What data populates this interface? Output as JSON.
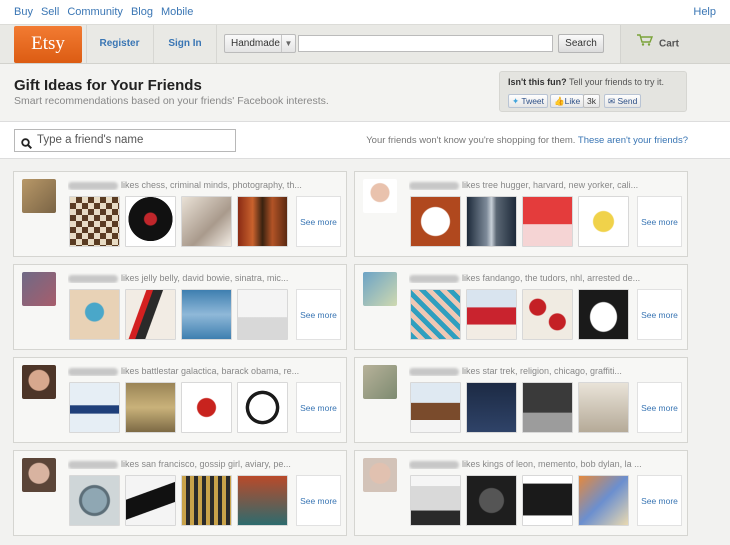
{
  "topnav": {
    "items": [
      "Buy",
      "Sell",
      "Community",
      "Blog",
      "Mobile"
    ],
    "help": "Help"
  },
  "header": {
    "logo": "Etsy",
    "register": "Register",
    "signin": "Sign In",
    "category": "Handmade",
    "search_value": "",
    "search_button": "Search",
    "cart": "Cart"
  },
  "hero": {
    "title": "Gift Ideas for Your Friends",
    "subtitle": "Smart recommendations based on your friends' Facebook interests.",
    "share_question": "Isn't this fun?",
    "share_prompt": "Tell your friends to try it.",
    "tweet": "Tweet",
    "like": "Like",
    "like_count": "3k",
    "send": "Send"
  },
  "finder": {
    "placeholder": "Type a friend's name",
    "note": "Your friends won't know you're shopping for them.",
    "note_link": "These aren't your friends?"
  },
  "accent": "#3a76b4",
  "brand": "#f1641e",
  "cards": [
    {
      "likes": "likes chess, criminal minds, photography, th...",
      "see_more": "See more"
    },
    {
      "likes": "likes tree hugger, harvard, new yorker, cali...",
      "see_more": "See more"
    },
    {
      "likes": "likes jelly belly, david bowie, sinatra, mic...",
      "see_more": "See more"
    },
    {
      "likes": "likes fandango, the tudors, nhl, arrested de...",
      "see_more": "See more"
    },
    {
      "likes": "likes battlestar galactica, barack obama, re...",
      "see_more": "See more"
    },
    {
      "likes": "likes star trek, religion, chicago, graffiti...",
      "see_more": "See more"
    },
    {
      "likes": "likes san francisco, gossip girl, aviary, pe...",
      "see_more": "See more"
    },
    {
      "likes": "likes kings of leon, memento, bob dylan, la ...",
      "see_more": "See more"
    }
  ]
}
